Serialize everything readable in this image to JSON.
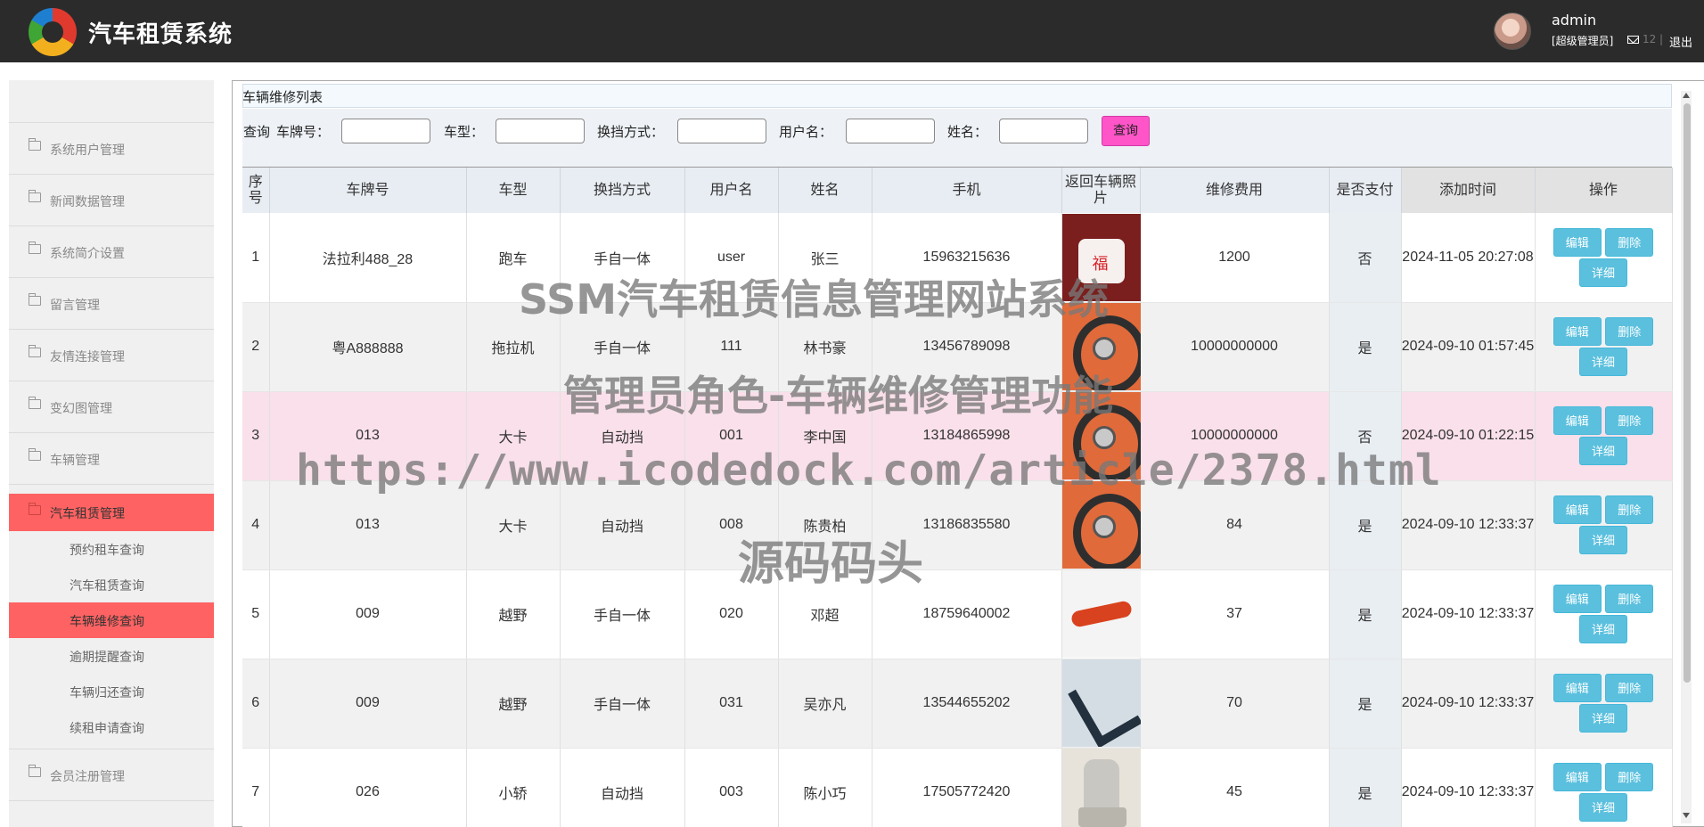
{
  "header": {
    "app_title": "汽车租赁系统",
    "username": "admin",
    "role": "[超级管理员]",
    "message_count": "12",
    "separator": "|",
    "logout_label": "退出"
  },
  "sidebar": {
    "items_before": [
      {
        "label": "系统用户管理"
      },
      {
        "label": "新闻数据管理"
      },
      {
        "label": "系统简介设置"
      },
      {
        "label": "留言管理"
      },
      {
        "label": "友情连接管理"
      },
      {
        "label": "变幻图管理"
      },
      {
        "label": "车辆管理"
      }
    ],
    "active_group": {
      "label": "汽车租赁管理"
    },
    "sub_items": [
      {
        "label": "预约租车查询"
      },
      {
        "label": "汽车租赁查询"
      },
      {
        "label": "车辆维修查询"
      },
      {
        "label": "逾期提醒查询"
      },
      {
        "label": "车辆归还查询"
      },
      {
        "label": "续租申请查询"
      }
    ],
    "items_after": [
      {
        "label": "会员注册管理"
      }
    ]
  },
  "panel": {
    "title": "车辆维修列表"
  },
  "search": {
    "prefix": "查询",
    "fields": [
      {
        "label": "车牌号：",
        "value": ""
      },
      {
        "label": "车型：",
        "value": ""
      },
      {
        "label": "换挡方式：",
        "value": ""
      },
      {
        "label": "用户名：",
        "value": ""
      },
      {
        "label": "姓名：",
        "value": ""
      }
    ],
    "button_label": "查询"
  },
  "table": {
    "headers": [
      "序号",
      "车牌号",
      "车型",
      "换挡方式",
      "用户名",
      "姓名",
      "手机",
      "返回车辆照片",
      "维修费用",
      "是否支付",
      "添加时间",
      "操作"
    ],
    "rows": [
      {
        "no": "1",
        "plate": "法拉利488_28",
        "type": "跑车",
        "gear": "手自一体",
        "user": "user",
        "name": "张三",
        "phone": "15963215636",
        "photo": "cake-photo",
        "fee": "1200",
        "paid": "否",
        "time": "2024-11-05 20:27:08"
      },
      {
        "no": "2",
        "plate": "粤A888888",
        "type": "拖拉机",
        "gear": "手自一体",
        "user": "111",
        "name": "林书豪",
        "phone": "13456789098",
        "photo": "steering-wheel-photo",
        "fee": "10000000000",
        "paid": "是",
        "time": "2024-09-10 01:57:45"
      },
      {
        "no": "3",
        "plate": "013",
        "type": "大卡",
        "gear": "自动挡",
        "user": "001",
        "name": "李中国",
        "phone": "13184865998",
        "photo": "steering-wheel-photo",
        "fee": "10000000000",
        "paid": "否",
        "time": "2024-09-10 01:22:15"
      },
      {
        "no": "4",
        "plate": "013",
        "type": "大卡",
        "gear": "自动挡",
        "user": "008",
        "name": "陈贵柏",
        "phone": "13186835580",
        "photo": "steering-wheel-photo",
        "fee": "84",
        "paid": "是",
        "time": "2024-09-10 12:33:37"
      },
      {
        "no": "5",
        "plate": "009",
        "type": "越野",
        "gear": "手自一体",
        "user": "020",
        "name": "邓超",
        "phone": "18759640002",
        "photo": "door-handle-photo",
        "fee": "37",
        "paid": "是",
        "time": "2024-09-10 12:33:37"
      },
      {
        "no": "6",
        "plate": "009",
        "type": "越野",
        "gear": "手自一体",
        "user": "031",
        "name": "吴亦凡",
        "phone": "13544655202",
        "photo": "control-arm-photo",
        "fee": "70",
        "paid": "是",
        "time": "2024-09-10 12:33:37"
      },
      {
        "no": "7",
        "plate": "026",
        "type": "小轿",
        "gear": "自动挡",
        "user": "003",
        "name": "陈小巧",
        "phone": "17505772420",
        "photo": "seat-photo",
        "fee": "45",
        "paid": "是",
        "time": "2024-09-10 12:33:37"
      }
    ],
    "actions": {
      "edit": "编辑",
      "delete": "删除",
      "detail": "详细"
    }
  },
  "watermark": {
    "line1": "SSM汽车租赁信息管理网站系统",
    "line2": "管理员角色-车辆维修管理功能",
    "line3": "https://www.icodedock.com/article/2378.html",
    "line4": "源码码头"
  },
  "colors": {
    "header_bg": "#2b2b2b",
    "active_menu": "#ff6262",
    "search_button": "#ff55c8",
    "action_button": "#5bc0de",
    "highlight_row": "#f9e0ea"
  }
}
